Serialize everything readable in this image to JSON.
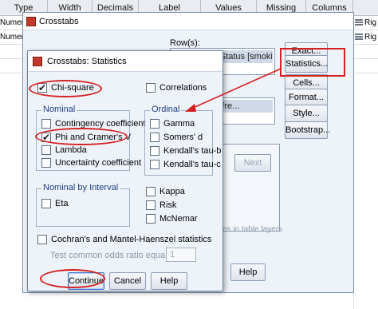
{
  "sheet": {
    "headers": [
      "Type",
      "Width",
      "Decimals",
      "Label",
      "Values",
      "Missing",
      "Columns"
    ],
    "rows": [
      {
        "left": "Numeri",
        "right": "Rig"
      },
      {
        "left": "Numeri",
        "right": "Rig"
      }
    ]
  },
  "crosstabs": {
    "title": "Crosstabs",
    "rows_label": "Row(s):",
    "row_item": "Smoking Status [smoki...",
    "col_item": "Exercise_fre...",
    "side_buttons": [
      "Exact...",
      "Statistics...",
      "Cells...",
      "Format...",
      "Style...",
      "Bootstrap..."
    ],
    "next_label": "Next",
    "layer_text": "es in table layers",
    "help_label": "Help"
  },
  "statistics": {
    "title": "Crosstabs: Statistics",
    "chi_square": "Chi-square",
    "correlations": "Correlations",
    "nominal": {
      "title": "Nominal",
      "items": [
        "Contingency coefficient",
        "Phi and Cramer's V",
        "Lambda",
        "Uncertainty coefficient"
      ]
    },
    "ordinal": {
      "title": "Ordinal",
      "items": [
        "Gamma",
        "Somers' d",
        "Kendall's tau-b",
        "Kendall's tau-c"
      ]
    },
    "nominal_interval": {
      "title": "Nominal by Interval",
      "items": [
        "Eta"
      ]
    },
    "other": [
      "Kappa",
      "Risk",
      "McNemar"
    ],
    "cochran": "Cochran's and Mantel-Haenszel statistics",
    "odds_label": "Test common odds ratio equals:",
    "odds_value": "1",
    "buttons": {
      "continue": "Continue",
      "cancel": "Cancel",
      "help": "Help"
    }
  },
  "colors": {
    "annotation": "#d42020",
    "accent": "#3a72c8"
  }
}
